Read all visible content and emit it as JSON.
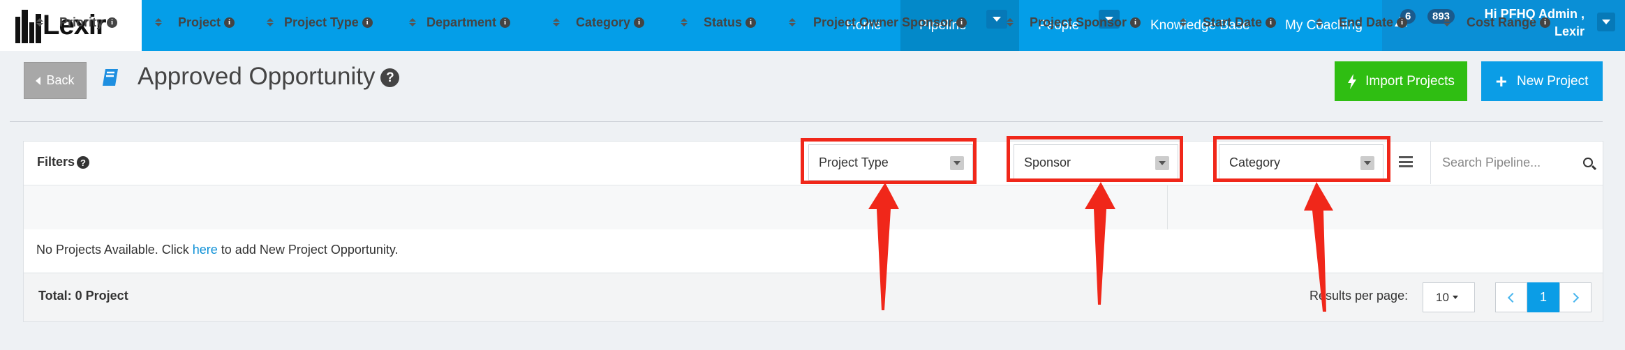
{
  "brand": {
    "name": "Lexir"
  },
  "nav": {
    "home": "Home",
    "pipeline": "Pipeline",
    "people": "People",
    "knowledge_base": "Knowledge Base",
    "my_coaching": "My Coaching",
    "alert_count": "6",
    "notification_count": "893",
    "user_line1": "Hi PFHQ Admin ,",
    "user_line2": "Lexir"
  },
  "header": {
    "back_label": "Back",
    "title": "Approved Opportunity",
    "import_label": "Import Projects",
    "new_label": "New Project"
  },
  "filters": {
    "label": "Filters",
    "project_type": "Project Type",
    "sponsor": "Sponsor",
    "category": "Category",
    "search_placeholder": "Search Pipeline..."
  },
  "table": {
    "columns": [
      "Priority",
      "Project",
      "Project Type",
      "Department",
      "Category",
      "Status",
      "Project Owner Sponsor",
      "Project Sponsor",
      "Start Date",
      "End Date",
      "Cost Range"
    ],
    "empty_prefix": "No Projects Available. Click ",
    "empty_link": "here",
    "empty_suffix": " to add New Project Opportunity."
  },
  "footer": {
    "total": "Total: 0 Project",
    "results_label": "Results per page:",
    "per_page": "10",
    "current_page": "1"
  },
  "colors": {
    "nav_bg": "#049ee8",
    "import_bg": "#2fbe12",
    "new_bg": "#0b9de6",
    "highlight": "#f0271a"
  }
}
